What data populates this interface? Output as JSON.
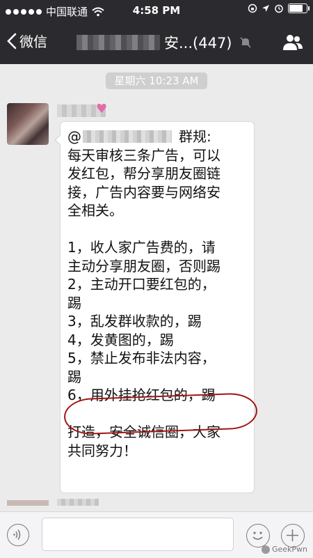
{
  "status_bar": {
    "carrier": "中国联通",
    "time": "4:58 PM",
    "signal_dots": 5,
    "battery_level": 0.85
  },
  "nav": {
    "back_label": "微信",
    "title_suffix": "安...(447)"
  },
  "chat": {
    "timestamp": "星期六 10:23 AM",
    "message": {
      "at_prefix": "@",
      "rules_label": "群规:",
      "lines": [
        "每天审核三条广告，可以",
        "发红包，帮分享朋友圈链",
        "接，广告内容要与网络安",
        "全相关。",
        "",
        "1，收人家广告费的，请",
        "主动分享朋友圈，否则踢",
        "2，主动开口要红包的，",
        "踢",
        "3，乱发群收款的，踢",
        "4，发黄图的，踢",
        "5，禁止发布非法内容，",
        "踢",
        "6，用外挂抢红包的，踢",
        "",
        "打造，安全诚信圈，大家",
        "共同努力！"
      ]
    }
  },
  "watermark": "GeekPwn",
  "colors": {
    "nav_bg": "#2b2b2f",
    "chat_bg": "#ebebeb",
    "highlight_circle": "#a21414"
  }
}
